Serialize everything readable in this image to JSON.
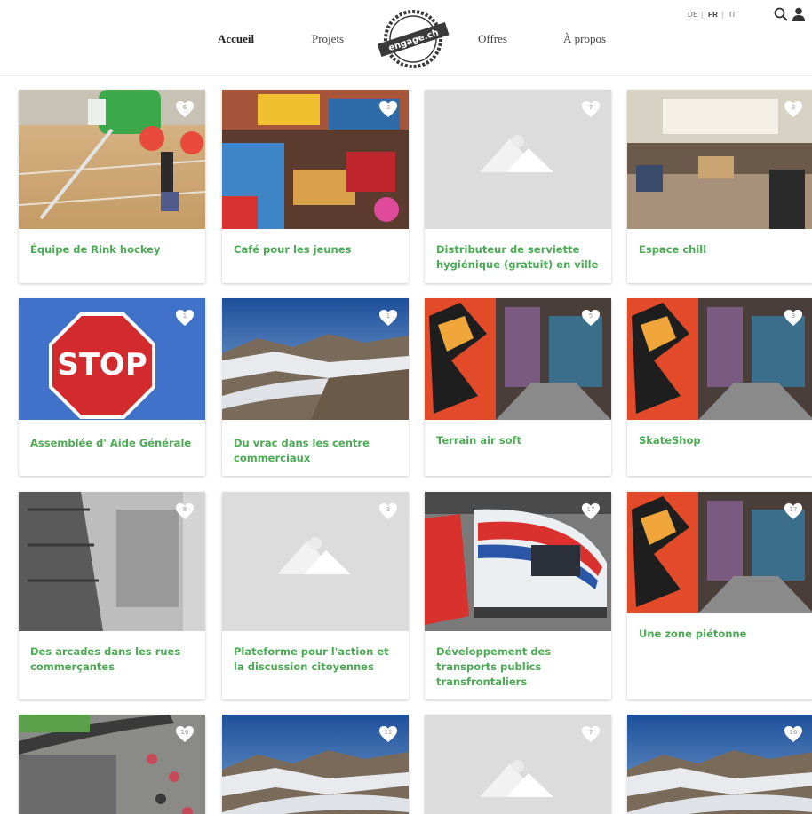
{
  "header": {
    "nav": [
      "Accueil",
      "Projets",
      "Offres",
      "À propos"
    ],
    "languages": [
      "DE",
      "FR",
      "IT"
    ],
    "active_language": "FR",
    "logo_text": "engage.ch"
  },
  "colors": {
    "accent": "#4caa54",
    "heart": "#ffffff"
  },
  "cards": [
    {
      "title": "Équipe de Rink hockey",
      "likes": "6",
      "image": "rink-hockey-photo"
    },
    {
      "title": "Café pour les jeunes",
      "likes": "3",
      "image": "cafe-lounge-photo"
    },
    {
      "title": "Distributeur de serviette hygiénique (gratuit) en ville",
      "likes": "7",
      "image": "placeholder-image"
    },
    {
      "title": "Espace chill",
      "likes": "3",
      "image": "chill-space-photo"
    },
    {
      "title": "Assemblée d' Aide Générale",
      "likes": "1",
      "image": "stop-sign-photo"
    },
    {
      "title": "Du vrac dans les centre commerciaux",
      "likes": "1",
      "image": "glacier-photo"
    },
    {
      "title": "Terrain air soft",
      "likes": "5",
      "image": "graffiti-alley-photo"
    },
    {
      "title": "SkateShop",
      "likes": "3",
      "image": "graffiti-alley-photo"
    },
    {
      "title": "Des arcades dans les rues commerçantes",
      "likes": "8",
      "image": "arcade-street-photo"
    },
    {
      "title": "Plateforme pour l'action et la discussion citoyennes",
      "likes": "3",
      "image": "placeholder-image"
    },
    {
      "title": "Développement des transports publics transfrontaliers",
      "likes": "17",
      "image": "train-photo"
    },
    {
      "title": "Une zone piétonne",
      "likes": "17",
      "image": "graffiti-alley-photo"
    },
    {
      "title": "",
      "likes": "16",
      "image": "aerial-street-photo"
    },
    {
      "title": "",
      "likes": "12",
      "image": "glacier-photo"
    },
    {
      "title": "",
      "likes": "7",
      "image": "placeholder-image"
    },
    {
      "title": "",
      "likes": "16",
      "image": "glacier-photo"
    }
  ]
}
